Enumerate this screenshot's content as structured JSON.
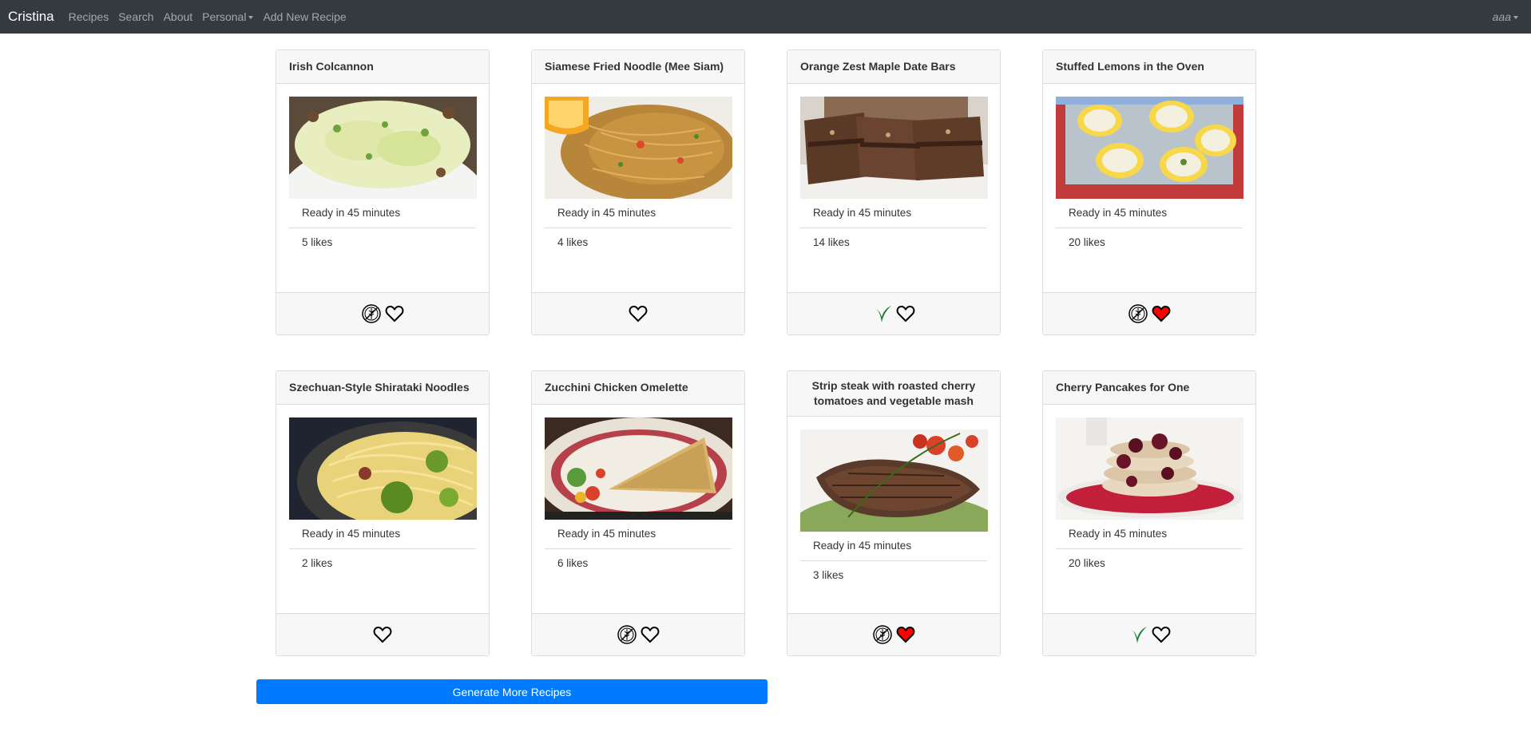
{
  "nav": {
    "brand": "Cristina",
    "links": [
      "Recipes",
      "Search",
      "About",
      "Personal",
      "Add New Recipe"
    ],
    "user": "aaa"
  },
  "recipes": [
    {
      "title": "Irish Colcannon",
      "ready": "Ready in 45 minutes",
      "likes": "5 likes",
      "gluten_free": true,
      "vegan": false,
      "liked": false
    },
    {
      "title": "Siamese Fried Noodle (Mee Siam)",
      "ready": "Ready in 45 minutes",
      "likes": "4 likes",
      "gluten_free": false,
      "vegan": false,
      "liked": false
    },
    {
      "title": "Orange Zest Maple Date Bars",
      "ready": "Ready in 45 minutes",
      "likes": "14 likes",
      "gluten_free": false,
      "vegan": true,
      "liked": false
    },
    {
      "title": "Stuffed Lemons in the Oven",
      "ready": "Ready in 45 minutes",
      "likes": "20 likes",
      "gluten_free": true,
      "vegan": false,
      "liked": true
    },
    {
      "title": "Szechuan-Style Shirataki Noodles",
      "ready": "Ready in 45 minutes",
      "likes": "2 likes",
      "gluten_free": false,
      "vegan": false,
      "liked": false
    },
    {
      "title": "Zucchini Chicken Omelette",
      "ready": "Ready in 45 minutes",
      "likes": "6 likes",
      "gluten_free": true,
      "vegan": false,
      "liked": false
    },
    {
      "title": "Strip steak with roasted cherry tomatoes and vegetable mash",
      "ready": "Ready in 45 minutes",
      "likes": "3 likes",
      "gluten_free": true,
      "vegan": false,
      "liked": true
    },
    {
      "title": "Cherry Pancakes for One",
      "ready": "Ready in 45 minutes",
      "likes": "20 likes",
      "gluten_free": false,
      "vegan": true,
      "liked": false
    }
  ],
  "generate_button": "Generate More Recipes",
  "colors": {
    "navbar": "#343a40",
    "primary": "#007bff",
    "liked_heart": "#ff0000",
    "vegan_leaf": "#1e7e34"
  },
  "icons": {
    "gluten_free": "gluten-free-icon",
    "vegan": "vegan-leaf-icon",
    "like": "heart-icon"
  }
}
